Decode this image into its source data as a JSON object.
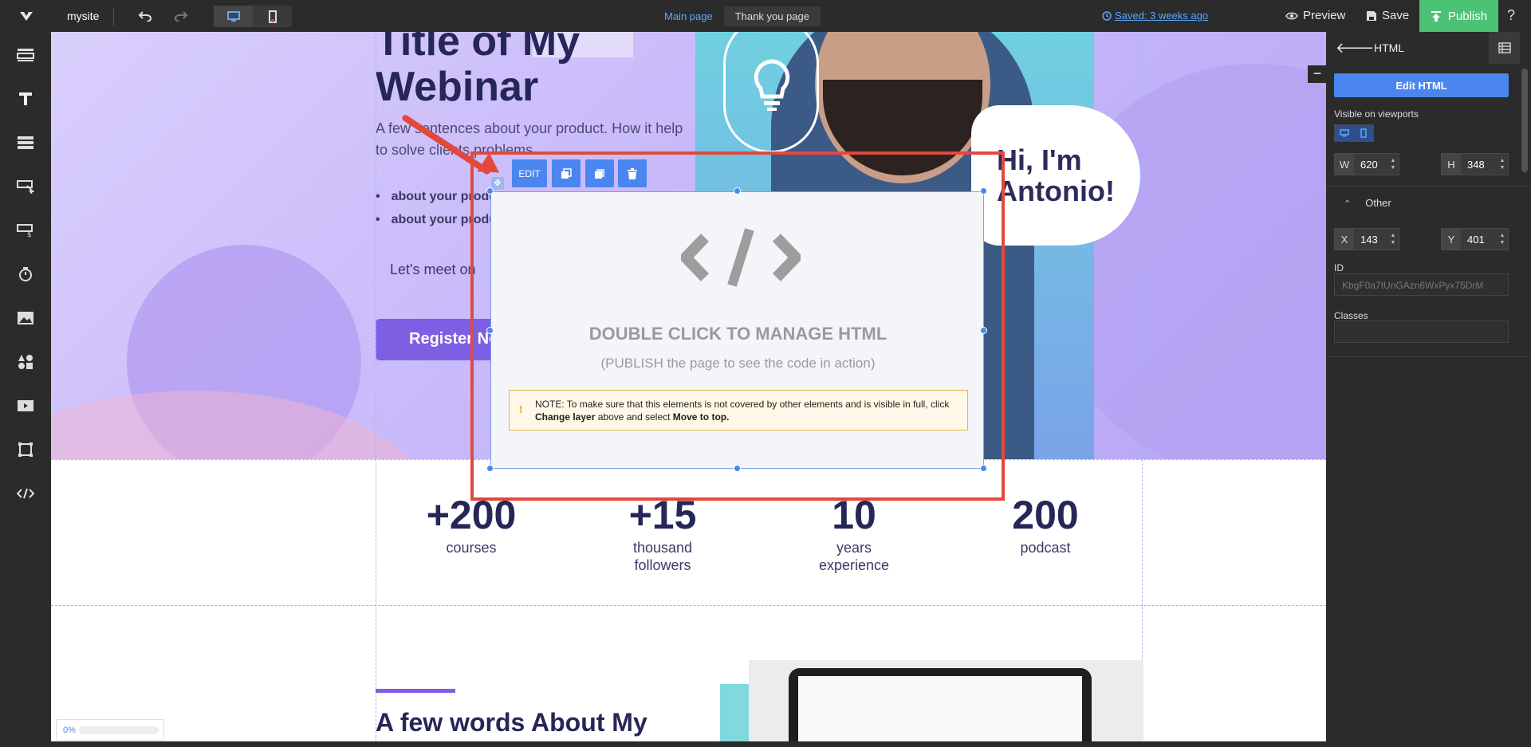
{
  "topbar": {
    "site_name": "mysite",
    "pages": [
      {
        "label": "Main page",
        "active": true
      },
      {
        "label": "Thank you page",
        "active": false
      }
    ],
    "saved": "Saved: 3 weeks ago",
    "preview": "Preview",
    "save": "Save",
    "publish": "Publish",
    "help": "?",
    "accent": "#5aa7ff",
    "publish_color": "#4cc277"
  },
  "left_tools": [
    "section-icon",
    "text-icon",
    "rows-icon",
    "button-icon",
    "form-icon",
    "timer-icon",
    "image-icon",
    "icons-icon",
    "video-icon",
    "shape-icon",
    "html-icon"
  ],
  "hero": {
    "title_line1": "Title of My",
    "title_line2": "Webinar",
    "subtitle": "A few sentences about your product. How it help to solve clients problems.",
    "bullets": [
      "about your product",
      "about your product"
    ],
    "meet": "Let's meet on",
    "register": "Register Now",
    "bubble": "Hi, I'm Antonio!"
  },
  "stats": [
    {
      "num": "+200",
      "label": "courses"
    },
    {
      "num": "+15",
      "label": "thousand followers"
    },
    {
      "num": "10",
      "label": "years experience"
    },
    {
      "num": "200",
      "label": "podcast"
    }
  ],
  "about": {
    "title": "A few words About My"
  },
  "widget": {
    "edit": "EDIT",
    "dbl": "DOUBLE CLICK TO MANAGE HTML",
    "pub": "(PUBLISH the page to see the code in action)",
    "note_prefix": "NOTE: To make sure that this elements is not covered by other elements and is visible in full, click",
    "note_bold1": "Change layer",
    "note_mid": "above and select",
    "note_bold2": "Move to top."
  },
  "progress": {
    "label": "0%",
    "value": 0
  },
  "panel": {
    "title": "HTML",
    "edit_html": "Edit HTML",
    "visible": "Visible on viewports",
    "w_key": "W",
    "w": "620",
    "h_key": "H",
    "h": "348",
    "other": "Other",
    "x_key": "X",
    "x": "143",
    "y_key": "Y",
    "y": "401",
    "id_label": "ID",
    "id_value": "KbgF0a7tUnGAzn6WxPyx75DrM",
    "classes_label": "Classes"
  }
}
